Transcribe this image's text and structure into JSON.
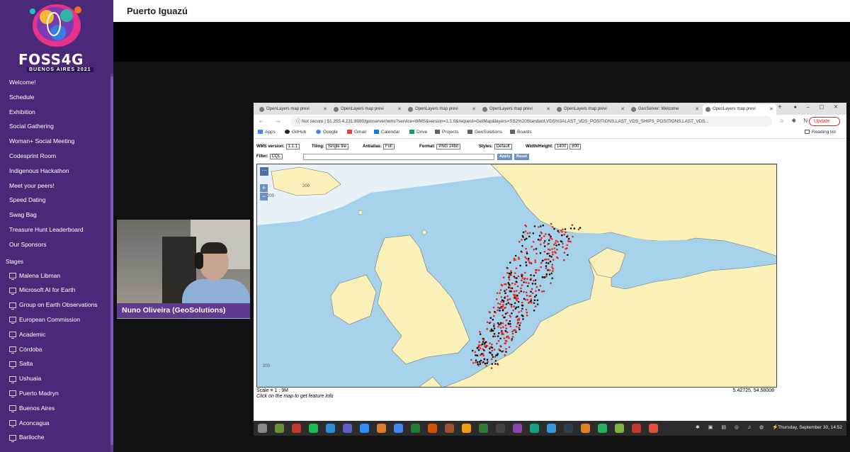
{
  "event": {
    "logo_text": "FOSS4G",
    "logo_subtitle": "BUENOS AIRES 2021"
  },
  "sidebar": {
    "items": [
      {
        "label": "Welcome!"
      },
      {
        "label": "Schedule"
      },
      {
        "label": "Exhibition"
      },
      {
        "label": "Social Gathering"
      },
      {
        "label": "Woman+ Social Meeting"
      },
      {
        "label": "Codesprint Room"
      },
      {
        "label": "Indigenous Hackathon"
      },
      {
        "label": "Meet your peers!"
      },
      {
        "label": "Speed Dating"
      },
      {
        "label": "Swag Bag"
      },
      {
        "label": "Treasure Hunt Leaderboard"
      },
      {
        "label": "Our Sponsors"
      }
    ],
    "stages_heading": "Stages",
    "stages": [
      {
        "label": "Malena Libman"
      },
      {
        "label": "Microsoft AI for Earth"
      },
      {
        "label": "Group on Earth Observations"
      },
      {
        "label": "European Commission"
      },
      {
        "label": "Academic"
      },
      {
        "label": "Córdoba"
      },
      {
        "label": "Salta"
      },
      {
        "label": "Ushuaia"
      },
      {
        "label": "Puerto Madryn"
      },
      {
        "label": "Buenos Aires"
      },
      {
        "label": "Aconcagua"
      },
      {
        "label": "Bariloche"
      }
    ]
  },
  "header": {
    "title": "Puerto Iguazú"
  },
  "speaker": {
    "name": "Nuno Oliveira (GeoSolutions)"
  },
  "browser": {
    "tabs": [
      {
        "label": "OpenLayers map previ"
      },
      {
        "label": "OpenLayers map previ"
      },
      {
        "label": "OpenLayers map previ"
      },
      {
        "label": "OpenLayers map previ"
      },
      {
        "label": "OpenLayers map previ"
      },
      {
        "label": "GeoServer: Welcome"
      },
      {
        "label": "OpenLayers map previ"
      }
    ],
    "security_label": "Not secure",
    "url": "51.255.4.231:8080/geoserver/wms?service=WMS&version=1.1.0&request=GetMap&layers=SS2%20Standard,VDS%3ALAST_VDS_POSITIONS,LAST_VDS_SHIPS_POSITIONS,LAST_VDS...",
    "update_label": "Update",
    "profile_initial": "N",
    "bookmarks": [
      {
        "label": "Apps",
        "color": "#4285f4"
      },
      {
        "label": "GitHub",
        "color": "#222222"
      },
      {
        "label": "Google",
        "color": "#4285f4"
      },
      {
        "label": "Gmail",
        "color": "#ea4335"
      },
      {
        "label": "Calendar",
        "color": "#1a73e8"
      },
      {
        "label": "Drive",
        "color": "#0f9d58"
      },
      {
        "label": "Projects",
        "color": "#5f6368"
      },
      {
        "label": "GeoSolutions",
        "color": "#5f6368"
      },
      {
        "label": "Boards",
        "color": "#5f6368"
      }
    ],
    "reading_list": "Reading list"
  },
  "ol_controls": {
    "wms_version_label": "WMS version:",
    "wms_version": "1.1.1",
    "tiling_label": "Tiling:",
    "tiling": "Single tile",
    "antialias_label": "Antialias:",
    "antialias": "Full",
    "format_label": "Format:",
    "format": "PNG 24bit",
    "styles_label": "Styles:",
    "styles": "Default",
    "wh_label": "Width/Height:",
    "width": "1400",
    "height": "800",
    "filter_label": "Filter:",
    "filter": "CQL",
    "apply_label": "Apply",
    "reset_label": "Reset"
  },
  "map": {
    "depth_labels": [
      "200",
      "200",
      "200"
    ],
    "scale": "Scale = 1 : 9M",
    "hint": "Click on the map to get feature info",
    "coords": "5.42725, 54.58008",
    "colors": {
      "sea": "#a6d1ea",
      "land": "#f9f1b8",
      "ice": "#e8f1f8",
      "ship": "#e8261c",
      "ship_dark": "#111111"
    }
  },
  "taskbar": {
    "datetime": "Thursday, September 30, 14:52"
  }
}
